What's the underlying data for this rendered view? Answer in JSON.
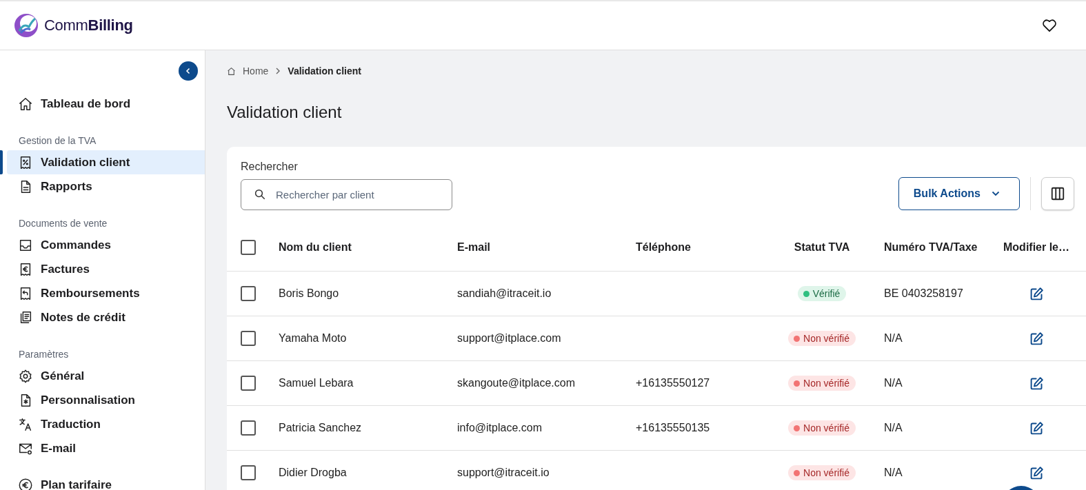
{
  "header": {
    "logo_text": {
      "regular": "Comm",
      "bold": "Billing"
    }
  },
  "sidebar": {
    "sections": [
      {
        "items": [
          {
            "label": "Tableau de bord",
            "selected": false
          }
        ]
      },
      {
        "heading": "Gestion de la TVA",
        "items": [
          {
            "label": "Validation client",
            "selected": true
          },
          {
            "label": "Rapports",
            "selected": false
          }
        ]
      },
      {
        "heading": "Documents de vente",
        "items": [
          {
            "label": "Commandes",
            "selected": false
          },
          {
            "label": "Factures",
            "selected": false
          },
          {
            "label": "Remboursements",
            "selected": false
          },
          {
            "label": "Notes de crédit",
            "selected": false
          }
        ]
      },
      {
        "heading": "Paramètres",
        "items": [
          {
            "label": "Général",
            "selected": false
          },
          {
            "label": "Personnalisation",
            "selected": false
          },
          {
            "label": "Traduction",
            "selected": false
          },
          {
            "label": "E-mail",
            "selected": false
          }
        ]
      },
      {
        "items": [
          {
            "label": "Plan tarifaire",
            "selected": false
          }
        ]
      }
    ]
  },
  "breadcrumb": [
    "Home",
    "Validation client"
  ],
  "page_title": "Validation client",
  "search": {
    "label": "Rechercher",
    "placeholder": "Rechercher par client"
  },
  "bulk_actions": "Bulk Actions",
  "table": {
    "all_checked": false,
    "columns": [
      "Nom du client",
      "E-mail",
      "Téléphone",
      "Statut TVA",
      "Numéro TVA/Taxe",
      "Modifier le…"
    ],
    "rows": [
      {
        "checked": false,
        "name": "Boris Bongo",
        "email": "sandiah@itraceit.io",
        "status": {
          "kind": "verified",
          "label": "Vérifié"
        },
        "vat": "BE 0403258197"
      },
      {
        "checked": false,
        "name": "Yamaha Moto",
        "email": "support@itplace.com",
        "status": {
          "kind": "unverified",
          "label": "Non vérifié"
        },
        "vat": "N/A"
      },
      {
        "checked": false,
        "name": "Samuel Lebara",
        "email": "skangoute@itplace.com",
        "phone": "+16135550127",
        "status": {
          "kind": "unverified",
          "label": "Non vérifié"
        },
        "vat": "N/A"
      },
      {
        "checked": false,
        "name": "Patricia Sanchez",
        "email": "info@itplace.com",
        "phone": "+16135550135",
        "status": {
          "kind": "unverified",
          "label": "Non vérifié"
        },
        "vat": "N/A"
      },
      {
        "checked": false,
        "name": "Didier Drogba",
        "email": "support@itraceit.io",
        "status": {
          "kind": "unverified",
          "label": "Non vérifié"
        },
        "vat": "N/A"
      }
    ]
  }
}
